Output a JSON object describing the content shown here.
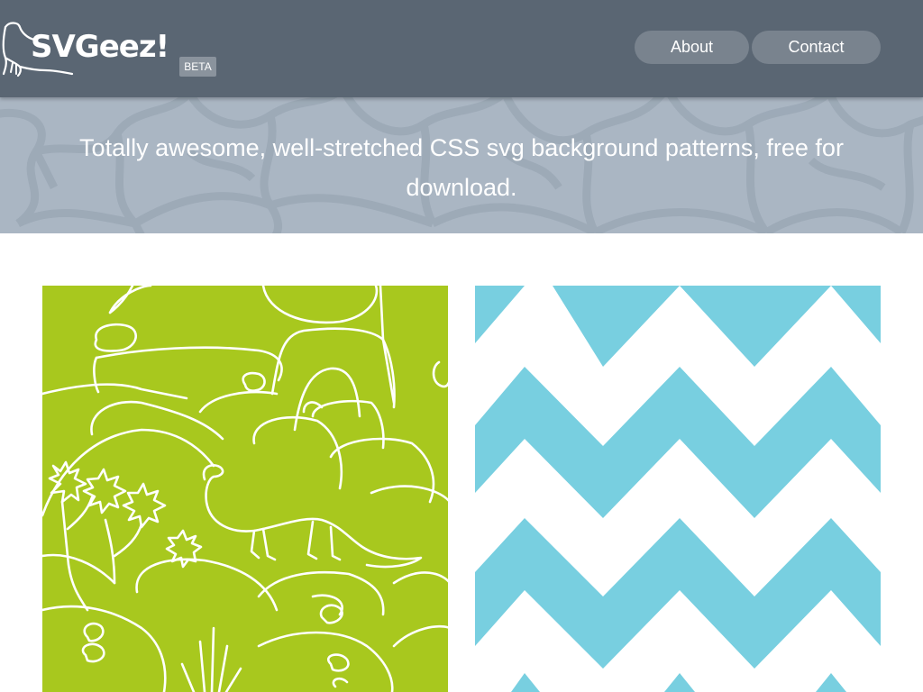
{
  "header": {
    "logo_text": "SVGeez!",
    "beta_label": "BETA",
    "logo_icon": "dinosaur-outline-icon",
    "nav": [
      {
        "label": "About"
      },
      {
        "label": "Contact"
      }
    ],
    "background_color": "#5a6673"
  },
  "hero": {
    "tagline": "Totally awesome, well-stretched CSS svg background patterns, free for download.",
    "background_color": "#aab6c3",
    "pattern": "stone-wall"
  },
  "patterns": [
    {
      "name": "dinosaur-landscape",
      "background_color": "#a8c81e",
      "line_color": "#ffffff"
    },
    {
      "name": "chevron-zigzag",
      "background_color": "#78cfe0",
      "stripe_color": "#ffffff"
    }
  ]
}
